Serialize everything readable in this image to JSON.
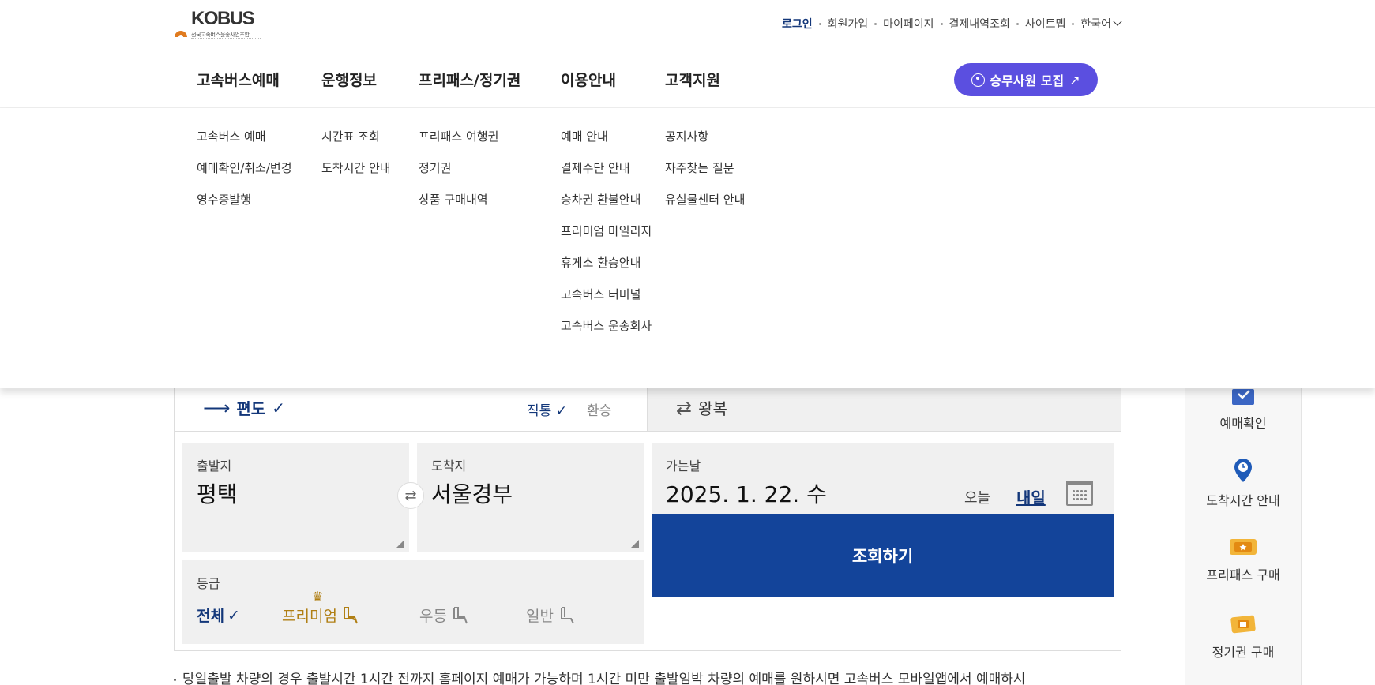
{
  "logo": {
    "brand": "KOBUS",
    "subtitle": "전국고속버스운송사업조합"
  },
  "util_nav": [
    {
      "label": "로그인"
    },
    {
      "label": "회원가입"
    },
    {
      "label": "마이페이지"
    },
    {
      "label": "결제내역조회"
    },
    {
      "label": "사이트맵"
    },
    {
      "label": "한국어"
    }
  ],
  "gnb": {
    "menus": [
      {
        "label": "고속버스예매",
        "subs": [
          "고속버스 예매",
          "예매확인/취소/변경",
          "영수증발행"
        ]
      },
      {
        "label": "운행정보",
        "subs": [
          "시간표 조회",
          "도착시간 안내"
        ]
      },
      {
        "label": "프리패스/정기권",
        "subs": [
          "프리패스 여행권",
          "정기권",
          "상품 구매내역"
        ]
      },
      {
        "label": "이용안내",
        "subs": [
          "예매 안내",
          "결제수단 안내",
          "승차권 환불안내",
          "프리미엄 마일리지",
          "휴게소 환승안내",
          "고속버스 터미널",
          "고속버스 운송회사"
        ]
      },
      {
        "label": "고객지원",
        "subs": [
          "공지사항",
          "자주찾는 질문",
          "유실물센터 안내"
        ]
      }
    ],
    "recruit_label": "승무사원 모집"
  },
  "booking": {
    "tab_oneway": "편도",
    "tab_roundtrip": "왕복",
    "route_direct": "직통",
    "route_transfer": "환승",
    "departure_caption": "출발지",
    "departure_value": "평택",
    "arrival_caption": "도착지",
    "arrival_value": "서울경부",
    "date_caption": "가는날",
    "date_value": "2025. 1. 22. 수",
    "today_label": "오늘",
    "tomorrow_label": "내일",
    "grade_caption": "등급",
    "grades": [
      "전체",
      "프리미엄",
      "우등",
      "일반"
    ],
    "search_label": "조회하기"
  },
  "notice": "당일출발 차량의 경우 출발시간 1시간 전까지 홈페이지 예매가 가능하며 1시간 미만 출발임박 차량의 예매를 원하시면 고속버스 모바일앱에서 예매하시",
  "quick_menu": [
    {
      "label": "예매확인",
      "icon": "ticket-check-icon"
    },
    {
      "label": "도착시간 안내",
      "icon": "location-pin-icon"
    },
    {
      "label": "프리패스 구매",
      "icon": "freepass-ticket-icon"
    },
    {
      "label": "정기권 구매",
      "icon": "commuter-pass-icon"
    }
  ],
  "colors": {
    "primary": "#13449a",
    "accent_purple": "#5b4fe0",
    "premium_gold": "#b07f14",
    "navy_text": "#13377a"
  }
}
